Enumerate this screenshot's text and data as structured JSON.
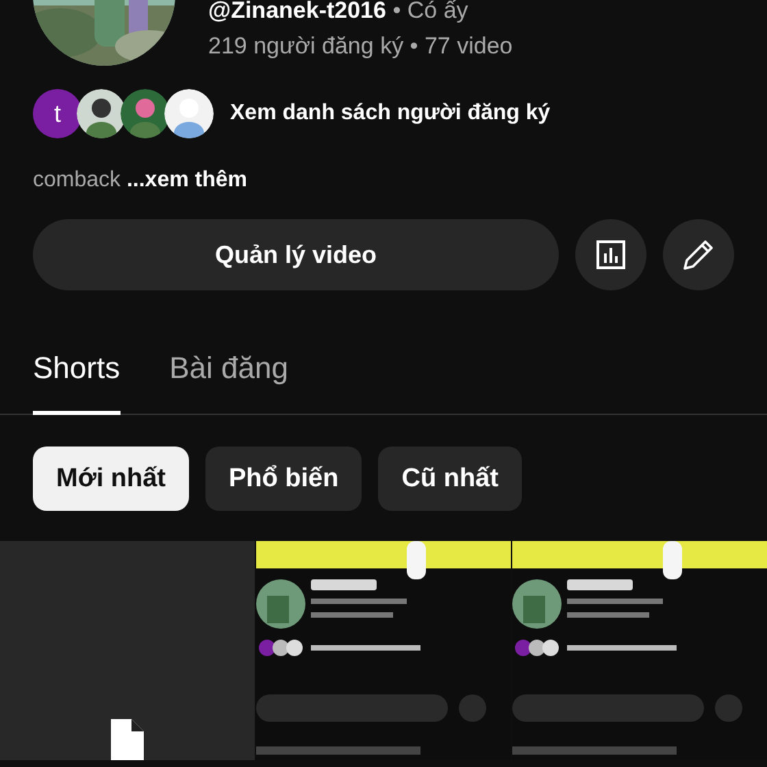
{
  "channel": {
    "meta": "**@Zinanek-t2016** • Có ấy",
    "stats": "219 người đăng ký • 77 video"
  },
  "subscribers": {
    "avatars": [
      {
        "kind": "letter",
        "letter": "t"
      },
      {
        "kind": "picture"
      },
      {
        "kind": "picture"
      },
      {
        "kind": "picture"
      }
    ],
    "label": "Xem danh sách người đăng ký"
  },
  "description": "comback **...xem thêm**",
  "manage_button": "Quản lý video",
  "tabs": [
    {
      "label": "Shorts",
      "selected": true
    },
    {
      "label": "Bài đăng",
      "selected": false
    }
  ],
  "filters": [
    {
      "label": "Mới nhất",
      "selected": true
    },
    {
      "label": "Phổ biến",
      "selected": false
    },
    {
      "label": "Cũ nhất",
      "selected": false
    }
  ],
  "shorts": [
    {
      "kind": "placeholder"
    },
    {
      "kind": "picture"
    },
    {
      "kind": "picture"
    }
  ]
}
